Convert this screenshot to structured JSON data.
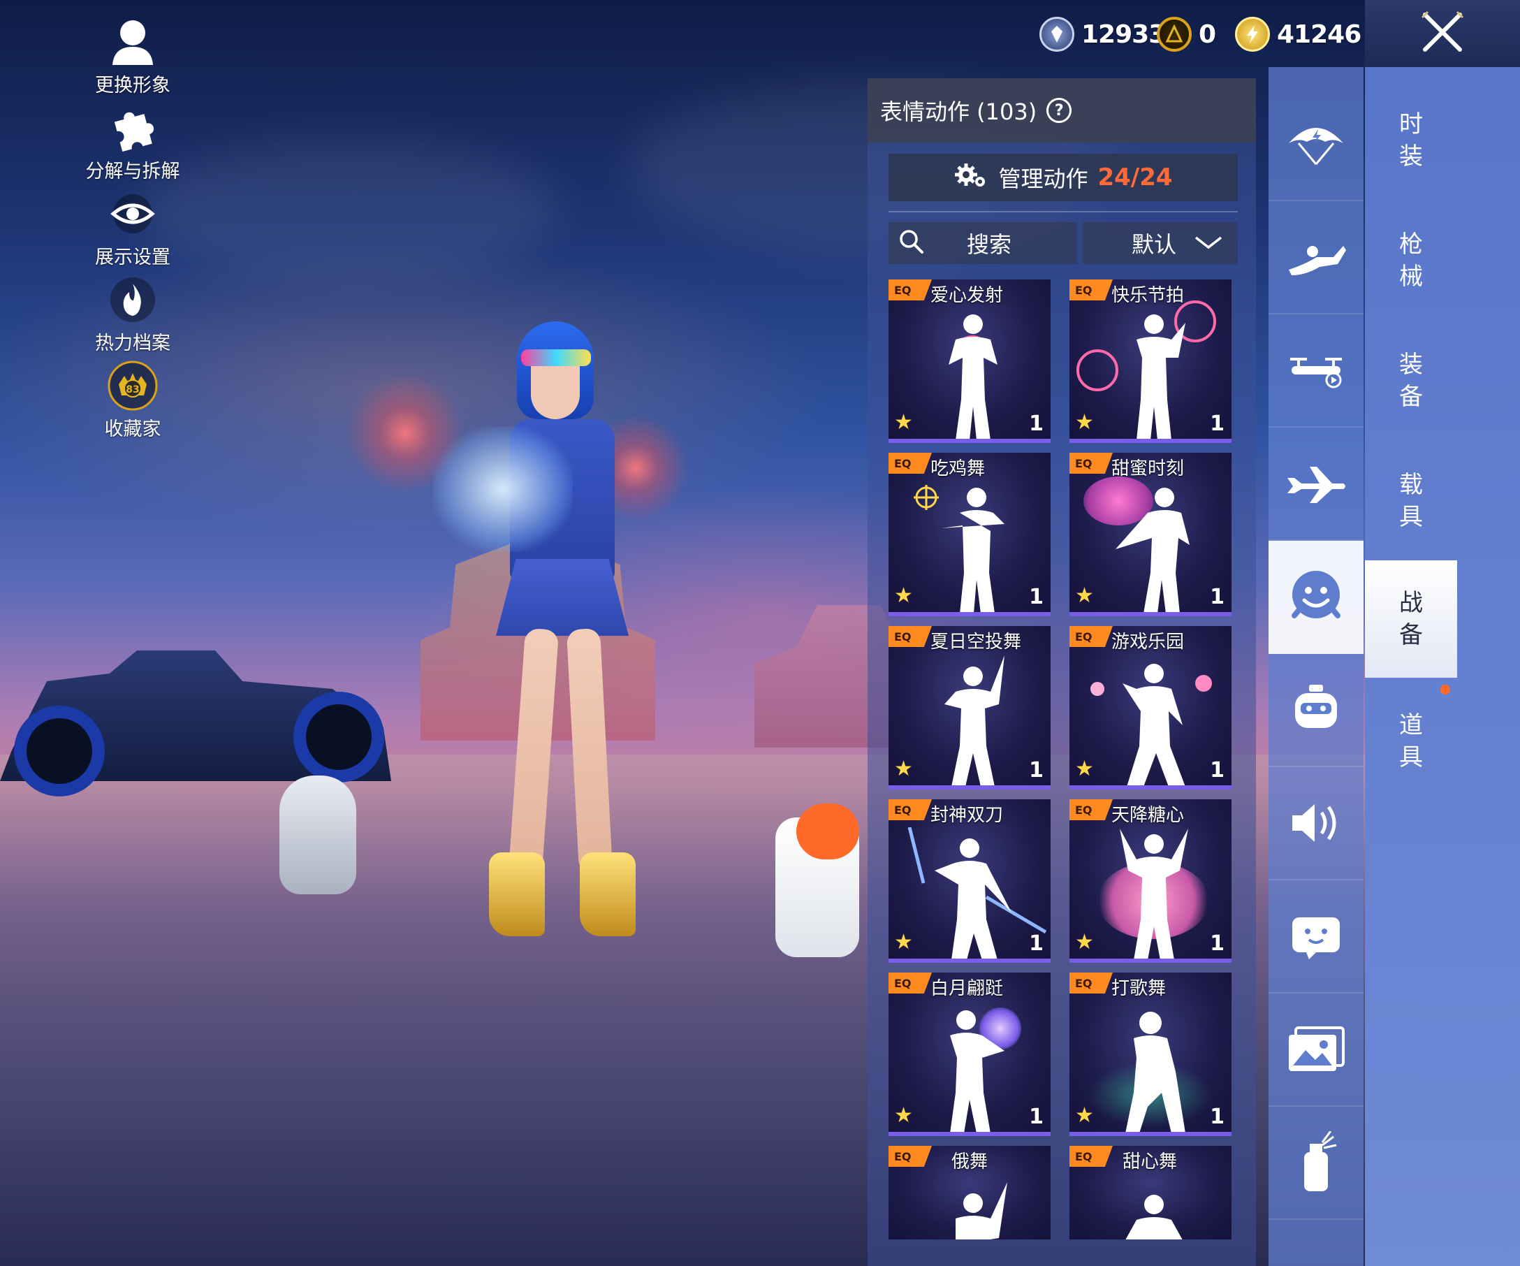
{
  "left_menu": [
    {
      "label": "更换形象",
      "icon": "avatar-icon"
    },
    {
      "label": "分解与拆解",
      "icon": "puzzle-icon"
    },
    {
      "label": "展示设置",
      "icon": "eye-icon"
    },
    {
      "label": "热力档案",
      "icon": "flame-icon"
    },
    {
      "label": "收藏家",
      "icon": "collector-badge-icon",
      "badge": "83"
    }
  ],
  "currency": [
    {
      "value": "12933",
      "icon": "silver-coin-icon",
      "color": "#3a4f8c"
    },
    {
      "value": "0",
      "icon": "gold-token-icon",
      "color": "#d9a21a"
    },
    {
      "value": "41246",
      "icon": "lightning-coin-icon",
      "color": "#e6b420"
    }
  ],
  "panel": {
    "title": "表情动作 (103)",
    "help": "?",
    "manage_label": "管理动作",
    "manage_count": "24/24",
    "search_label": "搜索",
    "sort_label": "默认"
  },
  "emotes": [
    {
      "name": "爱心发射",
      "count": "1",
      "tag": "EQ"
    },
    {
      "name": "快乐节拍",
      "count": "1",
      "tag": "EQ"
    },
    {
      "name": "吃鸡舞",
      "count": "1",
      "tag": "EQ"
    },
    {
      "name": "甜蜜时刻",
      "count": "1",
      "tag": "EQ"
    },
    {
      "name": "夏日空投舞",
      "count": "1",
      "tag": "EQ"
    },
    {
      "name": "游戏乐园",
      "count": "1",
      "tag": "EQ"
    },
    {
      "name": "封神双刀",
      "count": "1",
      "tag": "EQ"
    },
    {
      "name": "天降糖心",
      "count": "1",
      "tag": "EQ"
    },
    {
      "name": "白月翩跹",
      "count": "1",
      "tag": "EQ"
    },
    {
      "name": "打歌舞",
      "count": "1",
      "tag": "EQ"
    },
    {
      "name": "俄舞",
      "count": "",
      "tag": "EQ"
    },
    {
      "name": "甜心舞",
      "count": "",
      "tag": "EQ"
    }
  ],
  "categories": [
    {
      "icon": "parachute-icon"
    },
    {
      "icon": "skydive-icon"
    },
    {
      "icon": "drone-icon"
    },
    {
      "icon": "airplane-icon"
    },
    {
      "icon": "emote-face-icon",
      "active": true
    },
    {
      "icon": "robot-icon"
    },
    {
      "icon": "speaker-icon"
    },
    {
      "icon": "sticker-icon"
    },
    {
      "icon": "gallery-icon"
    },
    {
      "icon": "spray-icon"
    }
  ],
  "tabs": [
    {
      "label": [
        "时",
        "装"
      ]
    },
    {
      "label": [
        "枪",
        "械"
      ]
    },
    {
      "label": [
        "装",
        "备"
      ]
    },
    {
      "label": [
        "载",
        "具"
      ]
    },
    {
      "label": [
        "战",
        "备"
      ],
      "active": true
    },
    {
      "label": [
        "道",
        "具"
      ]
    }
  ],
  "colors": {
    "accent_orange": "#ff6a3a",
    "card_border": "#7a5de8",
    "tag_orange": "#ff8a1f"
  }
}
